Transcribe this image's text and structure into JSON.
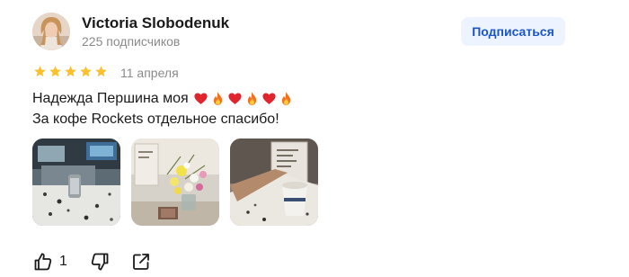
{
  "author": {
    "name": "Victoria Slobodenuk",
    "subscribers": "225 подписчиков",
    "avatar_icon": "user-avatar-photo"
  },
  "subscribe": {
    "label": "Подписаться"
  },
  "review": {
    "rating": 5,
    "rating_max": 5,
    "date": "11 апреля",
    "line1": "Надежда Першина моя",
    "line1_emojis": [
      "red-heart-icon",
      "fire-icon",
      "red-heart-icon",
      "fire-icon",
      "red-heart-icon",
      "fire-icon"
    ],
    "line2": "За кофе Rockets отдельное спасибо!"
  },
  "photos": [
    "cafe-interior-photo",
    "flowers-photo",
    "coffee-cup-photo"
  ],
  "actions": {
    "likes": "1",
    "icons": [
      "thumbs-up-icon",
      "thumbs-down-icon",
      "share-icon"
    ]
  },
  "colors": {
    "star": "#fbc02d",
    "accent": "#1b56c9",
    "subscribe_bg": "#edf3ff",
    "muted_text": "#8a8a8a"
  }
}
